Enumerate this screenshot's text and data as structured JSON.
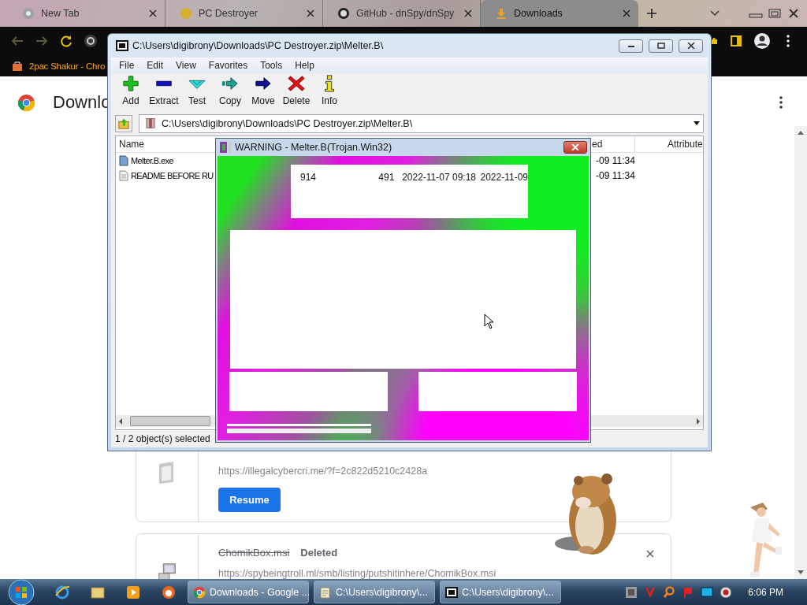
{
  "browser": {
    "tabs": [
      {
        "title": "New Tab",
        "kind": "newtab",
        "selected": false
      },
      {
        "title": "PC Destroyer",
        "kind": "site",
        "selected": false
      },
      {
        "title": "GitHub - dnSpy/dnSpy",
        "kind": "github",
        "selected": false
      },
      {
        "title": "Downloads",
        "kind": "downloads",
        "selected": true
      }
    ],
    "bookmarks": [
      {
        "title": "2pac Shakur - Chro"
      }
    ],
    "page": {
      "heading": "Downlo",
      "downloads": [
        {
          "url": "https://illegalcybercri.me/?f=2c822d5210c2428a",
          "action": "Resume"
        },
        {
          "file": "ChomikBox.msi",
          "removed": true,
          "status": "Deleted",
          "url": "https://spybeingtroll.ml/smb/listing/putshitinhere/ChomikBox.msi"
        }
      ]
    }
  },
  "archive_window": {
    "title": "C:\\Users\\digibrony\\Downloads\\PC Destroyer.zip\\Melter.B\\",
    "menu": [
      "File",
      "Edit",
      "View",
      "Favorites",
      "Tools",
      "Help"
    ],
    "toolbar": [
      {
        "label": "Add",
        "kind": "add"
      },
      {
        "label": "Extract",
        "kind": "extract"
      },
      {
        "label": "Test",
        "kind": "test"
      },
      {
        "label": "Copy",
        "kind": "copy"
      },
      {
        "label": "Move",
        "kind": "move"
      },
      {
        "label": "Delete",
        "kind": "delete"
      },
      {
        "label": "Info",
        "kind": "info"
      }
    ],
    "address": "C:\\Users\\digibrony\\Downloads\\PC Destroyer.zip\\Melter.B\\",
    "columns": [
      "Name",
      "ed",
      "Attribute"
    ],
    "rows": [
      {
        "name": "Melter.B.exe",
        "kind": "exe",
        "column_2": "-09 11:34"
      },
      {
        "name": "README BEFORE RU",
        "kind": "text",
        "column_2": "-09 11:34"
      }
    ],
    "status": "1 / 2 object(s) selected"
  },
  "warning_window": {
    "title": "WARNING - Melter.B(Trojan.Win32)",
    "row": [
      "914",
      "491",
      "2022-11-07 09:18",
      "2022-11-09"
    ]
  },
  "taskbar": {
    "tasks": [
      {
        "label": "Downloads - Google ...",
        "kind": "chrome"
      },
      {
        "label": "C:\\Users\\digibrony\\...",
        "kind": "notepad"
      },
      {
        "label": "C:\\Users\\digibrony\\...",
        "kind": "archiver"
      }
    ],
    "clock": "6:06 PM"
  }
}
